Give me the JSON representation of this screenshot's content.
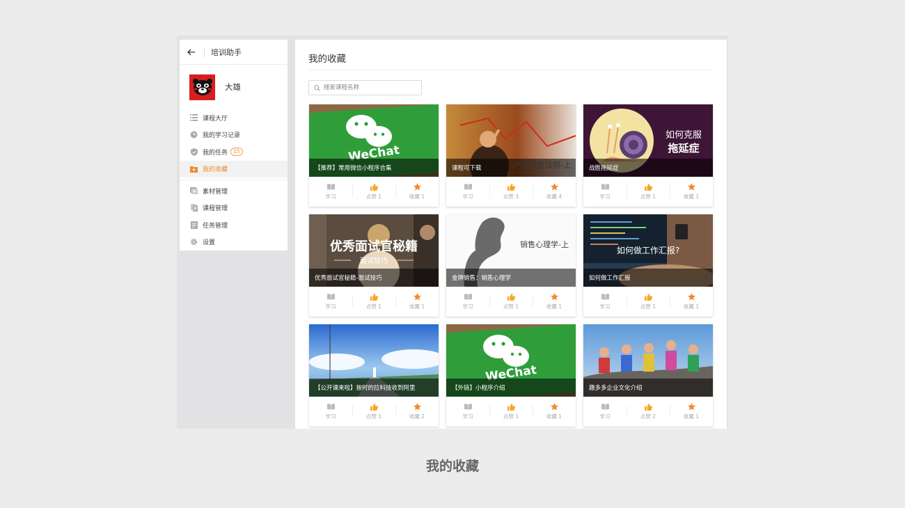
{
  "sidebar": {
    "title": "培训助手",
    "user_name": "大雄",
    "items": [
      {
        "label": "课程大厅",
        "icon": "list-icon"
      },
      {
        "label": "我的学习记录",
        "icon": "clock-icon"
      },
      {
        "label": "我的任务",
        "icon": "shield-icon",
        "badge": "15"
      },
      {
        "label": "我的收藏",
        "icon": "folder-star-icon",
        "active": true
      }
    ],
    "admin_items": [
      {
        "label": "素材管理",
        "icon": "media-icon"
      },
      {
        "label": "课程管理",
        "icon": "document-icon"
      },
      {
        "label": "任务管理",
        "icon": "task-icon"
      },
      {
        "label": "设置",
        "icon": "gear-icon"
      }
    ]
  },
  "main": {
    "title": "我的收藏",
    "search_placeholder": "搜索课程名称",
    "actions": {
      "study": "学习",
      "like": "点赞",
      "fav": "收藏"
    },
    "cards": [
      {
        "title": "【推荐】常用微信小程序合集",
        "thumb": "wechat",
        "thumb_text": "WeChat",
        "likes": "1",
        "favs": "1"
      },
      {
        "title": "课程可下载",
        "thumb": "spin",
        "thumb_text": "SPIN销售法则-上",
        "likes": "3",
        "favs": "4"
      },
      {
        "title": "战胜拖延症",
        "thumb": "snail",
        "thumb_text": "如何克服 拖延症",
        "likes": "1",
        "favs": "1"
      },
      {
        "title": "优秀面试官秘籍-面试技巧",
        "thumb": "interview",
        "thumb_text": "优秀面试官秘籍",
        "thumb_sub": "面试技巧",
        "likes": "1",
        "favs": "1"
      },
      {
        "title": "金牌销售：销售心理学",
        "thumb": "psych",
        "thumb_text": "销售心理学-上",
        "likes": "1",
        "favs": "1"
      },
      {
        "title": "如何做工作汇报",
        "thumb": "report",
        "thumb_text": "如何做工作汇报?",
        "likes": "1",
        "favs": "1"
      },
      {
        "title": "【公开课来啦】按时的拉科技收到阿里",
        "thumb": "sky",
        "likes": "1",
        "favs": "2"
      },
      {
        "title": "【外链】小程序介绍",
        "thumb": "wechat",
        "thumb_text": "WeChat",
        "likes": "1",
        "favs": "1"
      },
      {
        "title": "趣多多企业文化介绍",
        "thumb": "team",
        "likes": "2",
        "favs": "1"
      }
    ]
  },
  "footer_caption": "我的收藏",
  "colors": {
    "accent": "#f08a2e",
    "like": "#f5a623",
    "fav": "#f08a2e",
    "study": "#bbbbbb"
  }
}
